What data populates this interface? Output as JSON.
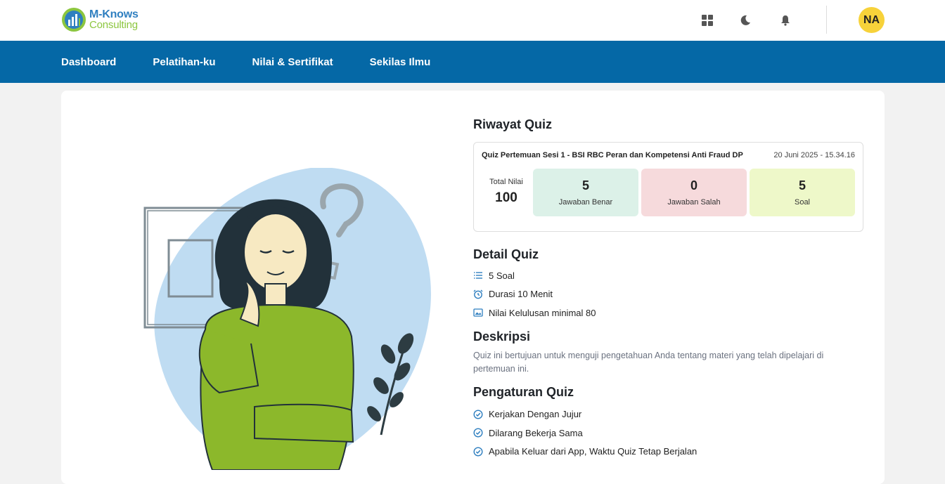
{
  "logo": {
    "line1": "M-Knows",
    "line2": "Consulting"
  },
  "header": {
    "icons": [
      "grid-icon",
      "moon-icon",
      "bell-icon"
    ],
    "avatar_initials": "NA"
  },
  "nav": {
    "items": [
      {
        "label": "Dashboard"
      },
      {
        "label": "Pelatihan-ku"
      },
      {
        "label": "Nilai & Sertifikat"
      },
      {
        "label": "Sekilas Ilmu"
      }
    ]
  },
  "riwayat": {
    "heading": "Riwayat Quiz",
    "quiz_title": "Quiz Pertemuan Sesi 1 - BSI RBC Peran dan Kompetensi Anti Fraud DP",
    "date": "20 Juni 2025 - 15.34.16",
    "total_label": "Total Nilai",
    "total_value": "100",
    "stats": [
      {
        "value": "5",
        "label": "Jawaban Benar",
        "color": "#dcf1e8"
      },
      {
        "value": "0",
        "label": "Jawaban Salah",
        "color": "#f6dadc"
      },
      {
        "value": "5",
        "label": "Soal",
        "color": "#eef8c9"
      }
    ]
  },
  "detail": {
    "heading": "Detail Quiz",
    "items": [
      {
        "icon": "list-icon",
        "text": "5 Soal"
      },
      {
        "icon": "alarm-clock-icon",
        "text": "Durasi 10 Menit"
      },
      {
        "icon": "image-icon",
        "text": "Nilai Kelulusan minimal 80"
      }
    ]
  },
  "deskripsi": {
    "heading": "Deskripsi",
    "text": "Quiz ini bertujuan untuk menguji pengetahuan Anda tentang materi yang telah dipelajari di pertemuan ini."
  },
  "pengaturan": {
    "heading": "Pengaturan Quiz",
    "items": [
      {
        "icon": "check-circle-icon",
        "text": "Kerjakan Dengan Jujur"
      },
      {
        "icon": "check-circle-icon",
        "text": "Dilarang Bekerja Sama"
      },
      {
        "icon": "check-circle-icon",
        "text": "Apabila Keluar dari App, Waktu Quiz Tetap Berjalan"
      }
    ]
  },
  "colors": {
    "nav_bg": "#0568a6",
    "accent_blue": "#2f7fc0",
    "accent_green": "#8cc63f",
    "avatar_bg": "#f7d23a"
  }
}
